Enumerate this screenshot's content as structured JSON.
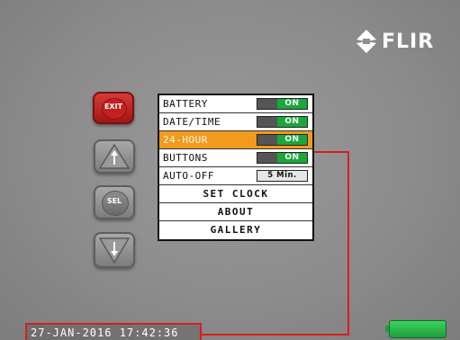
{
  "brand": {
    "logo_text": "FLIR",
    "logo_icon": "flir-diamond-icon"
  },
  "side_buttons": {
    "exit_label": "EXIT",
    "up_icon": "arrow-up-icon",
    "sel_label": "SEL",
    "down_icon": "arrow-down-icon"
  },
  "menu": {
    "items": [
      {
        "label": "BATTERY",
        "state": "ON"
      },
      {
        "label": "DATE/TIME",
        "state": "ON"
      },
      {
        "label": "24-HOUR",
        "state": "ON",
        "highlighted": true
      },
      {
        "label": "BUTTONS",
        "state": "ON"
      },
      {
        "label": "AUTO-OFF",
        "value": "5 Min."
      },
      {
        "label": "SET CLOCK"
      },
      {
        "label": "ABOUT"
      },
      {
        "label": "GALLERY"
      }
    ]
  },
  "status_bar": {
    "timestamp": "27-JAN-2016 17:42:36",
    "battery_icon": "battery-icon"
  },
  "colors": {
    "highlight": "#f39a1c",
    "toggle_on": "#1aa83a",
    "callout": "#d91d1d",
    "exit_button": "#c42020"
  }
}
